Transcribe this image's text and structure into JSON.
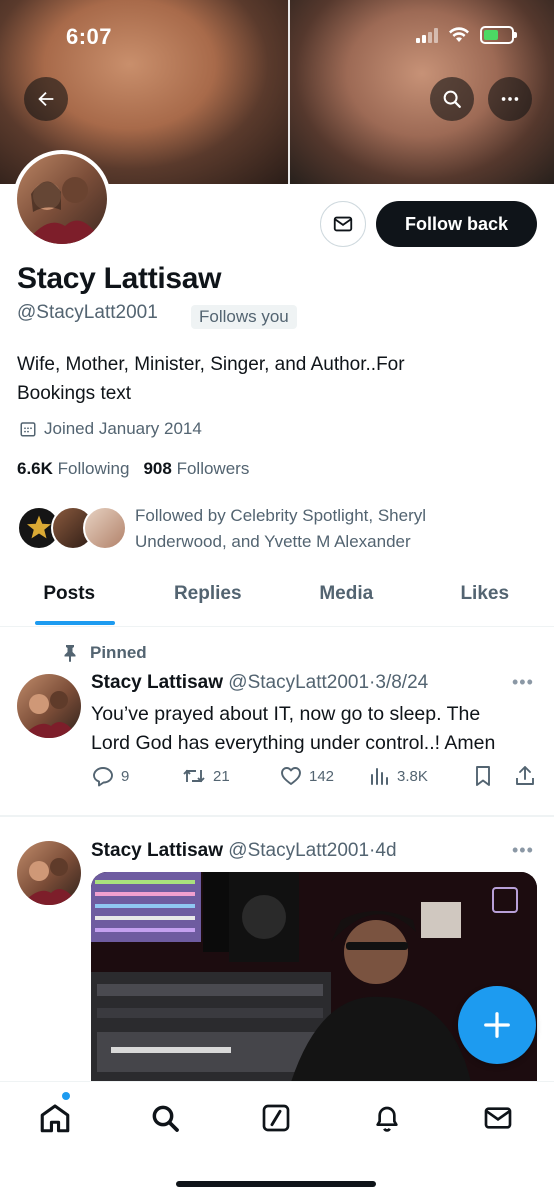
{
  "status_bar": {
    "time": "6:07"
  },
  "profile": {
    "display_name": "Stacy Lattisaw",
    "handle": "@StacyLatt2001",
    "follows_you": "Follows you",
    "follow_back": "Follow back",
    "bio_line1": "Wife, Mother, Minister, Singer, and Author..For",
    "bio_line2": "Bookings text",
    "joined": "Joined January 2014",
    "following_count": "6.6K",
    "following_label": "Following",
    "followers_count": "908",
    "followers_label": "Followers",
    "followed_by_line1": "Followed by Celebrity Spotlight, Sheryl",
    "followed_by_line2": "Underwood, and Yvette M Alexander"
  },
  "tabs": [
    {
      "label": "Posts"
    },
    {
      "label": "Replies"
    },
    {
      "label": "Media"
    },
    {
      "label": "Likes"
    }
  ],
  "posts": [
    {
      "pinned_label": "Pinned",
      "author": "Stacy Lattisaw",
      "handle": "@StacyLatt2001",
      "time": "3/8/24",
      "text_line1": "You’ve prayed about IT, now go to sleep. The",
      "text_line2": "Lord God has everything under control..! Amen",
      "replies": "9",
      "reposts": "21",
      "likes": "142",
      "views": "3.8K"
    },
    {
      "author": "Stacy Lattisaw",
      "handle": "@StacyLatt2001",
      "time": "4d"
    }
  ],
  "colors": {
    "accent": "#1d9bf0",
    "text": "#0f1419",
    "secondary": "#536471",
    "follow_button": "#0f1419"
  },
  "icons": {
    "back": "arrow-left-icon",
    "search": "search-icon",
    "more": "more-icon",
    "message": "envelope-icon",
    "calendar": "calendar-icon",
    "pin": "pin-icon",
    "reply": "reply-icon",
    "repost": "repost-icon",
    "like": "heart-icon",
    "views": "views-icon",
    "bookmark": "bookmark-icon",
    "share": "share-icon",
    "compose": "plus-icon"
  }
}
